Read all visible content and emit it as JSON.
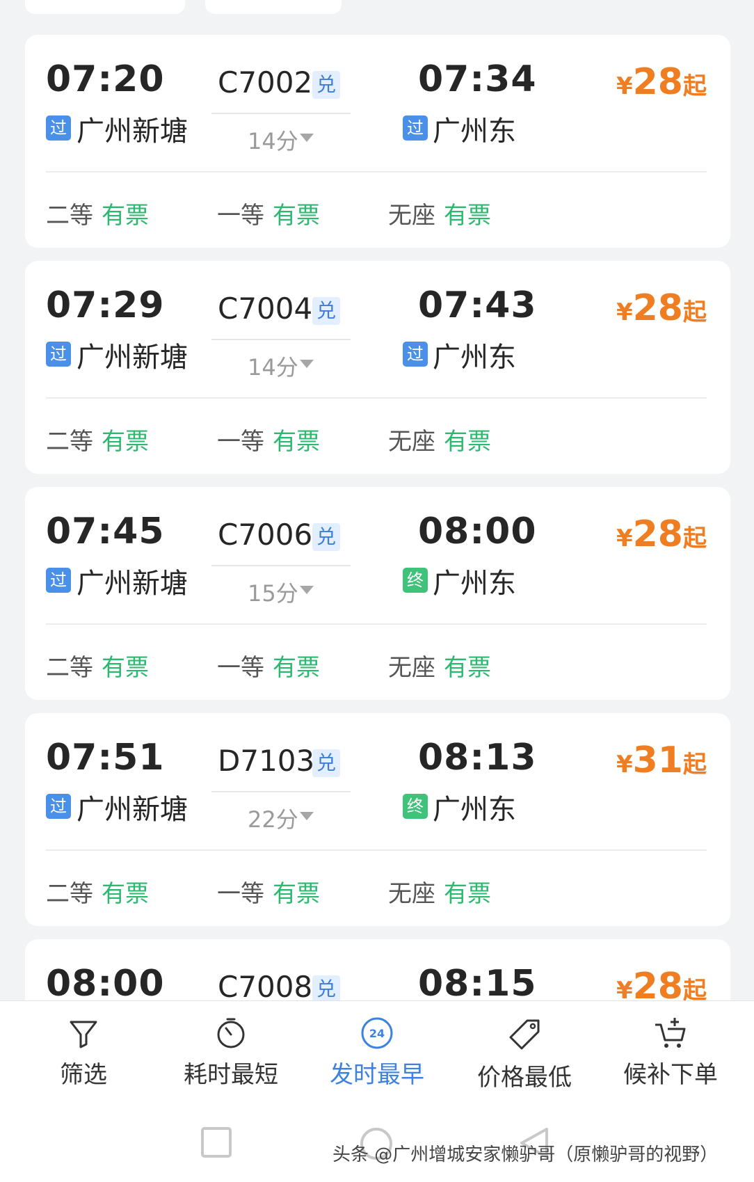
{
  "trains": [
    {
      "dep_time": "07:20",
      "train_no": "C7002",
      "badge": "兑",
      "duration": "14分",
      "arr_time": "07:34",
      "dep_tag": "过",
      "dep_station": "广州新塘",
      "arr_tag": "过",
      "arr_station": "广州东",
      "price_symbol": "¥",
      "price": "28",
      "price_suffix": "起",
      "seats": [
        {
          "cls": "二等",
          "avail": "有票"
        },
        {
          "cls": "一等",
          "avail": "有票"
        },
        {
          "cls": "无座",
          "avail": "有票"
        }
      ]
    },
    {
      "dep_time": "07:29",
      "train_no": "C7004",
      "badge": "兑",
      "duration": "14分",
      "arr_time": "07:43",
      "dep_tag": "过",
      "dep_station": "广州新塘",
      "arr_tag": "过",
      "arr_station": "广州东",
      "price_symbol": "¥",
      "price": "28",
      "price_suffix": "起",
      "seats": [
        {
          "cls": "二等",
          "avail": "有票"
        },
        {
          "cls": "一等",
          "avail": "有票"
        },
        {
          "cls": "无座",
          "avail": "有票"
        }
      ]
    },
    {
      "dep_time": "07:45",
      "train_no": "C7006",
      "badge": "兑",
      "duration": "15分",
      "arr_time": "08:00",
      "dep_tag": "过",
      "dep_station": "广州新塘",
      "arr_tag": "终",
      "arr_station": "广州东",
      "price_symbol": "¥",
      "price": "28",
      "price_suffix": "起",
      "seats": [
        {
          "cls": "二等",
          "avail": "有票"
        },
        {
          "cls": "一等",
          "avail": "有票"
        },
        {
          "cls": "无座",
          "avail": "有票"
        }
      ]
    },
    {
      "dep_time": "07:51",
      "train_no": "D7103",
      "badge": "兑",
      "duration": "22分",
      "arr_time": "08:13",
      "dep_tag": "过",
      "dep_station": "广州新塘",
      "arr_tag": "终",
      "arr_station": "广州东",
      "price_symbol": "¥",
      "price": "31",
      "price_suffix": "起",
      "seats": [
        {
          "cls": "二等",
          "avail": "有票"
        },
        {
          "cls": "一等",
          "avail": "有票"
        },
        {
          "cls": "无座",
          "avail": "有票"
        }
      ]
    },
    {
      "dep_time": "08:00",
      "train_no": "C7008",
      "badge": "兑",
      "arr_time": "08:15",
      "price_symbol": "¥",
      "price": "28",
      "price_suffix": "起"
    }
  ],
  "bottom_tabs": [
    {
      "label": "筛选",
      "icon": "filter-icon",
      "active": false
    },
    {
      "label": "耗时最短",
      "icon": "timer-icon",
      "active": false
    },
    {
      "label": "发时最早",
      "icon": "clock-24-icon",
      "active": true,
      "icon_text": "24"
    },
    {
      "label": "价格最低",
      "icon": "price-tag-icon",
      "active": false
    },
    {
      "label": "候补下单",
      "icon": "cart-add-icon",
      "active": false
    }
  ],
  "watermark": "头条 @广州增城安家懒驴哥（原懒驴哥的视野）",
  "colors": {
    "accent_blue": "#3d82e0",
    "price_orange": "#ef7d22",
    "available_green": "#2db870",
    "tag_blue": "#4a90e8",
    "tag_green": "#3fc27a"
  }
}
